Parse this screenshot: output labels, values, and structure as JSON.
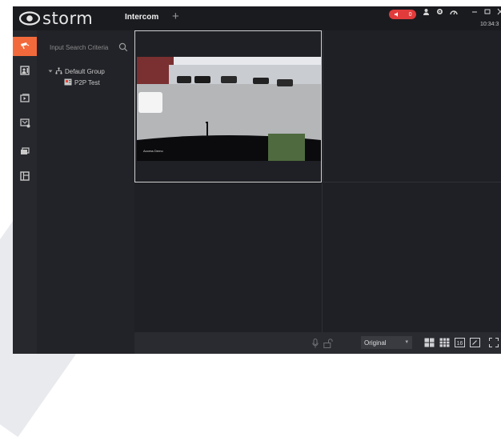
{
  "app": {
    "logo_text": "storm",
    "tab_label": "Intercom",
    "add_tab_symbol": "+",
    "alarm_count": "0",
    "clock_text": "10:34:3"
  },
  "sidebar_nav": {
    "items": [
      {
        "icon": "live-view-icon",
        "active": true
      },
      {
        "icon": "contacts-icon",
        "active": false
      },
      {
        "icon": "playback-icon",
        "active": false
      },
      {
        "icon": "device-icon",
        "active": false
      },
      {
        "icon": "storage-icon",
        "active": false
      },
      {
        "icon": "layout-icon",
        "active": false
      }
    ]
  },
  "tree": {
    "search_placeholder": "Input Search Criteria",
    "group_label": "Default Group",
    "device_label": "P2P Test"
  },
  "video": {
    "overlay_label": "Access Demo"
  },
  "bottom_bar": {
    "stream_select": "Original",
    "layout_icons": [
      "grid-4-icon",
      "grid-9-icon",
      "grid-16-icon",
      "edit-icon",
      "fullscreen-icon"
    ]
  },
  "colors": {
    "accent": "#f26a3b",
    "alarm": "#e23b3b",
    "background": "#1f2025"
  }
}
